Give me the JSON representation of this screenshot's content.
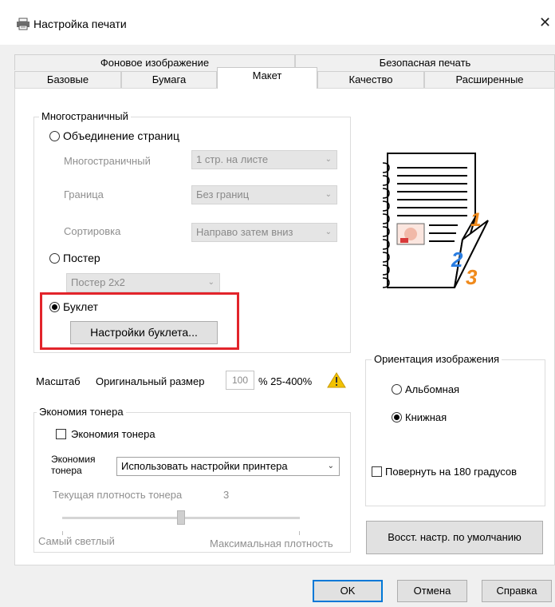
{
  "window": {
    "title": "Настройка печати",
    "close_glyph": "✕"
  },
  "tabs_row1": [
    {
      "label": "Фоновое изображение"
    },
    {
      "label": "Безопасная печать"
    }
  ],
  "tabs_row2": [
    {
      "label": "Базовые"
    },
    {
      "label": "Бумага"
    },
    {
      "label": "Макет",
      "active": true
    },
    {
      "label": "Качество"
    },
    {
      "label": "Расширенные"
    }
  ],
  "multipage": {
    "group_label": "Многостраничный",
    "combine_label": "Объединение страниц",
    "pages_label": "Многостраничный",
    "pages_value": "1 стр. на листе",
    "border_label": "Граница",
    "border_value": "Без границ",
    "order_label": "Сортировка",
    "order_value": "Направо затем вниз",
    "poster_label": "Постер",
    "poster_value": "Постер 2x2",
    "booklet_label": "Буклет",
    "booklet_button": "Настройки буклета..."
  },
  "scale": {
    "label": "Масштаб",
    "mode": "Оригинальный размер",
    "value": "100",
    "range": "% 25-400%"
  },
  "toner": {
    "group_label": "Экономия тонера",
    "checkbox_label": "Экономия тонера",
    "select_label_line1": "Экономия",
    "select_label_line2": "тонера",
    "select_value": "Использовать настройки принтера",
    "density_label": "Текущая плотность тонера",
    "density_value": "3",
    "slider_min_label": "Самый светлый",
    "slider_max_label": "Максимальная плотность",
    "slider_position": 0.5
  },
  "orientation": {
    "group_label": "Ориентация изображения",
    "landscape_label": "Альбомная",
    "portrait_label": "Книжная",
    "rotate_label": "Повернуть на 180 градусов"
  },
  "preview": {
    "page_numbers": [
      "1",
      "2",
      "3"
    ]
  },
  "buttons": {
    "restore_defaults": "Восст. настр. по умолчанию",
    "ok": "OK",
    "cancel": "Отмена",
    "help": "Справка"
  },
  "colors": {
    "accent_blue": "#0078d7",
    "highlight_red": "#e2242b",
    "warning_yellow": "#f2c200",
    "number_orange": "#f08a1c",
    "number_blue": "#2a7de1"
  },
  "icons": {
    "title_icon": "printer-icon",
    "warning_icon": "warning-icon"
  }
}
